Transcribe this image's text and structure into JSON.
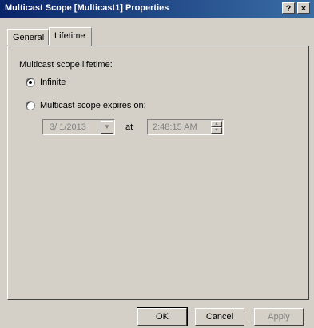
{
  "window": {
    "title": "Multicast Scope [Multicast1]  Properties",
    "help_label": "?",
    "close_label": "×"
  },
  "tabs": [
    {
      "label": "General",
      "active": false
    },
    {
      "label": "Lifetime",
      "active": true
    }
  ],
  "lifetime": {
    "heading": "Multicast scope lifetime:",
    "infinite_label": "Infinite",
    "infinite_selected": true,
    "expires_label": "Multicast scope expires on:",
    "expires_selected": false,
    "date_value": "3/  1/2013",
    "at_label": "at",
    "time_value": "2:48:15 AM"
  },
  "buttons": {
    "ok": "OK",
    "cancel": "Cancel",
    "apply": "Apply"
  },
  "icons": {
    "dropdown": "chevron-down-icon",
    "spin_up": "spin-up-icon",
    "spin_down": "spin-down-icon"
  }
}
